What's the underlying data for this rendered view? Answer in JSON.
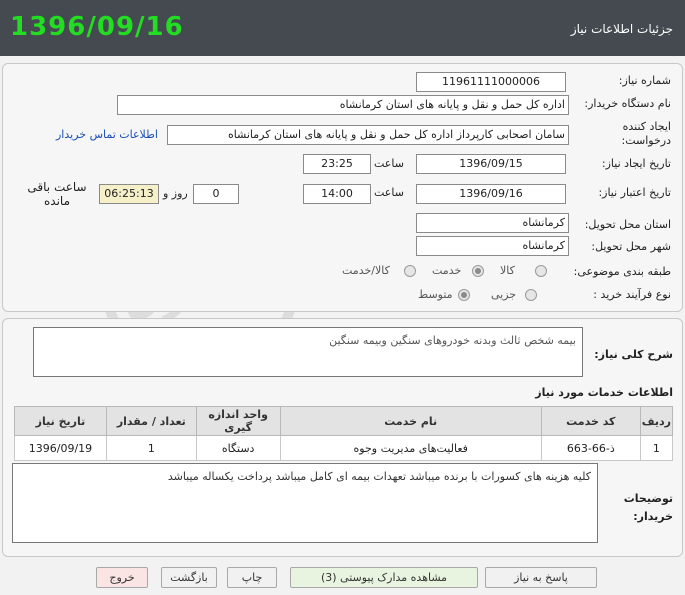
{
  "header": {
    "big_date": "1396/09/16",
    "title": "جزئیات اطلاعات نیاز"
  },
  "form": {
    "need_number_label": "شماره نیاز:",
    "need_number": "11961111000006",
    "buyer_org_label": "نام دستگاه خریدار:",
    "buyer_org": "اداره کل حمل و نقل و پایانه های استان کرمانشاه",
    "creator_label": "ایجاد کننده درخواست:",
    "creator": "سامان  اصحابی کارپرداز اداره کل حمل و نقل و پایانه های استان کرمانشاه",
    "contact_link": "اطلاعات تماس خریدار",
    "created_date_label": "تاریخ ایجاد نیاز:",
    "created_date": "1396/09/15",
    "time_label": "ساعت",
    "created_time": "23:25",
    "valid_date_label": "تاریخ اعتبار نیاز:",
    "valid_date": "1396/09/16",
    "valid_time": "14:00",
    "days_value": "0",
    "day_and_label": "روز و",
    "remaining_time": "06:25:13",
    "remaining_label": "ساعت باقی مانده",
    "province_label": "استان محل تحویل:",
    "province": "کرمانشاه",
    "city_label": "شهر محل تحویل:",
    "city": "کرمانشاه",
    "category_label": "طبقه بندی موضوعی:",
    "category_options": [
      "کالا",
      "خدمت",
      "کالا/خدمت"
    ],
    "category_selected": "خدمت",
    "process_label": "نوع فرآیند خرید :",
    "process_options": [
      "جزیی",
      "متوسط"
    ],
    "process_selected": "متوسط"
  },
  "description": {
    "label": "شرح کلی نیاز:",
    "text": "بیمه شخص ثالث وبدنه خودروهای سنگین وبیمه سنگین"
  },
  "services": {
    "title": "اطلاعات خدمات مورد نیاز",
    "headers": [
      "ردیف",
      "کد خدمت",
      "نام خدمت",
      "واحد اندازه گیری",
      "تعداد / مقدار",
      "تاریخ نیاز"
    ],
    "rows": [
      [
        "1",
        "ذ-66-663",
        "فعالیت‌های مدیریت وجوه",
        "دستگاه",
        "1",
        "1396/09/19"
      ]
    ]
  },
  "notes": {
    "label": "توضیحات خریدار:",
    "text": "کلیه هزینه های کسورات با برنده میباشد تعهدات بیمه ای کامل میباشد پرداخت یکساله میباشد"
  },
  "buttons": {
    "reply": "پاسخ به نیاز",
    "attachments": "مشاهده مدارک پیوستی (3)",
    "print": "چاپ",
    "back": "بازگشت",
    "exit": "خروج"
  },
  "watermark_text": [
    "هزاره",
    "ارتباط گستران"
  ]
}
